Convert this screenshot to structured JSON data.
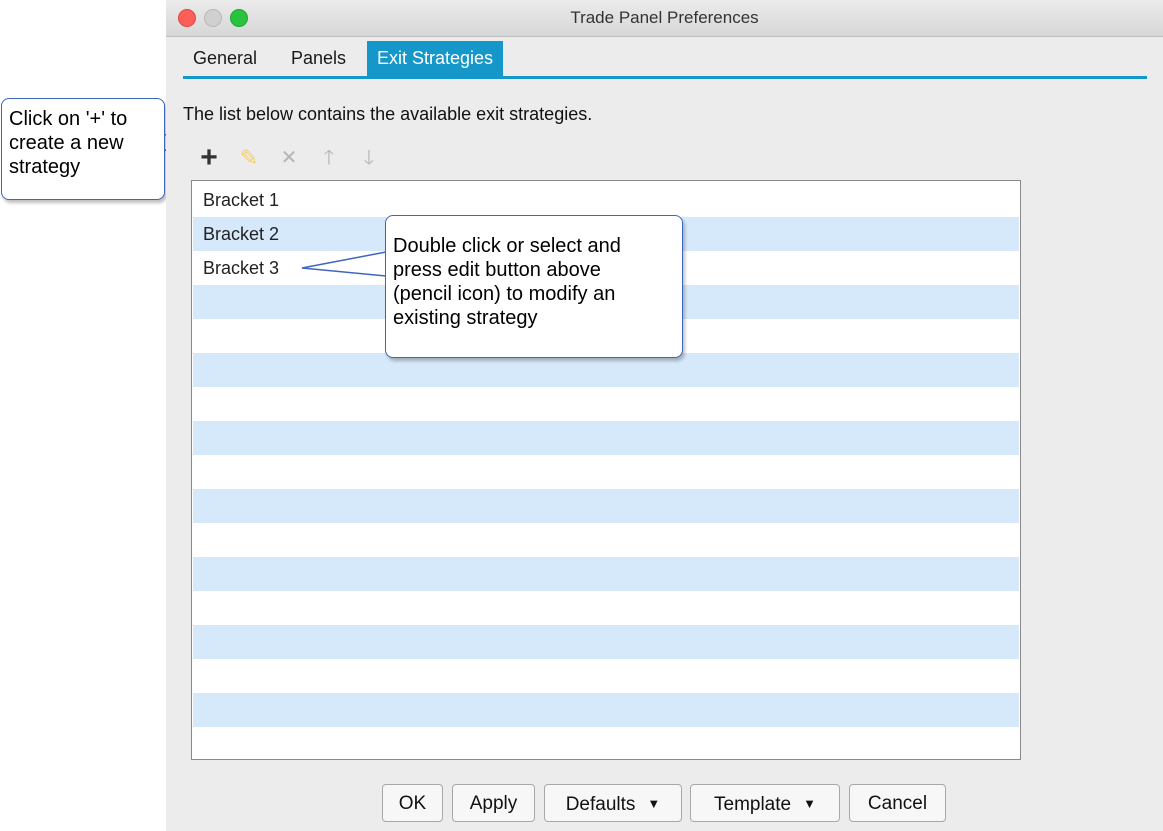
{
  "window": {
    "title": "Trade Panel Preferences"
  },
  "tabs": [
    {
      "label": "General"
    },
    {
      "label": "Panels"
    },
    {
      "label": "Exit Strategies"
    }
  ],
  "description": "The list below contains the available exit strategies.",
  "toolbar": {
    "add_glyph": "+",
    "edit_glyph": "✎",
    "delete_glyph": "✕",
    "up_glyph": "🡑",
    "down_glyph": "🡓"
  },
  "strategies": [
    "Bracket 1",
    "Bracket 2",
    "Bracket 3"
  ],
  "buttons": {
    "ok": "OK",
    "apply": "Apply",
    "defaults": "Defaults",
    "template": "Template",
    "cancel": "Cancel",
    "caret": "▼"
  },
  "callouts": {
    "add": [
      "Click on '+' to",
      "create a new",
      "strategy"
    ],
    "edit": [
      "Double click or select and",
      "press edit button above",
      "(pencil icon) to modify an",
      "existing strategy"
    ]
  },
  "colors": {
    "accent": "#1598c9",
    "row_alt": "#d6e9fa",
    "callout_border": "#3f66bf"
  }
}
